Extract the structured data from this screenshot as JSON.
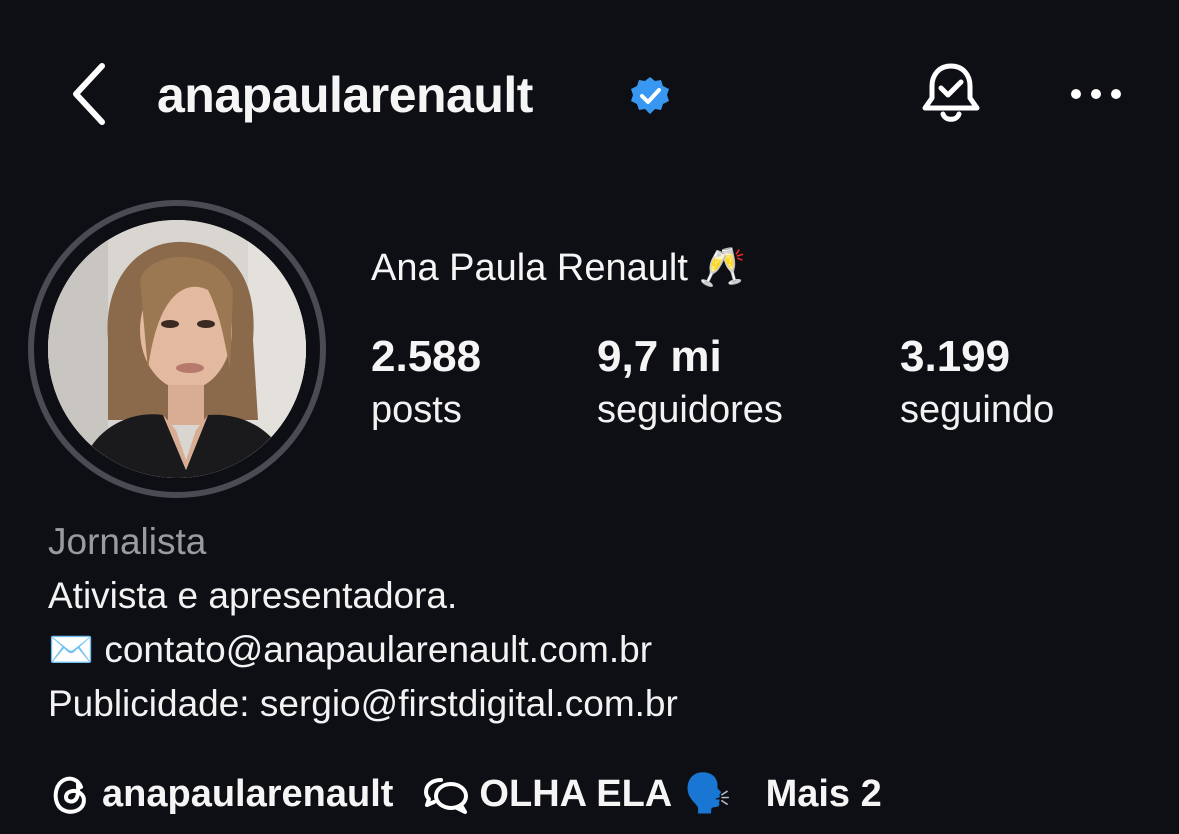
{
  "header": {
    "username": "anapaularenault",
    "verified": true,
    "colors": {
      "verified_badge": "#3897f0",
      "background": "#0e0f14"
    },
    "icons": [
      "back-arrow-icon",
      "verified-badge-icon",
      "notification-bell-check-icon",
      "more-options-icon"
    ]
  },
  "profile": {
    "display_name": "Ana Paula Renault",
    "name_emoji": "🥂",
    "stats": {
      "posts_count": "2.588",
      "posts_label": "posts",
      "followers_count": "9,7 mi",
      "followers_label": "seguidores",
      "following_count": "3.199",
      "following_label": "seguindo"
    }
  },
  "bio": {
    "category": "Jornalista",
    "line1": "Ativista e apresentadora.",
    "email_emoji": "✉️",
    "email": "contato@anapaularenault.com.br",
    "line3": "Publicidade: sergio@firstdigital.com.br"
  },
  "links": {
    "threads_handle": "anapaularenault",
    "channel_name": "OLHA ELA",
    "channel_emoji": "🗣️",
    "more_label": "Mais 2"
  }
}
